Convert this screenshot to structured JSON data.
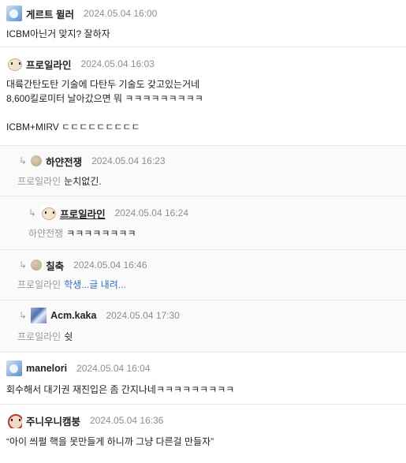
{
  "comments": [
    {
      "nick": "게르트 뮐러",
      "date": "2024.05.04 16:00",
      "avatar": "blue-mascot-icon",
      "lines": [
        "ICBM아닌거 맞지? 잘하자"
      ]
    },
    {
      "nick": "프로일라인",
      "date": "2024.05.04 16:03",
      "avatar": "puppy-icon",
      "lines": [
        "대륙간탄도탄 기술에 다탄두 기술도 갖고있는거네",
        "8,600킬로미터 날아갔으면 뭐 ㅋㅋㅋㅋㅋㅋㅋㅋㅋ",
        "",
        "ICBM+MIRV ㄷㄷㄷㄷㄷㄷㄷㄷㄷ"
      ]
    },
    {
      "nick": "하얀전쟁",
      "date": "2024.05.04 16:23",
      "avatar": "beige-circle-icon",
      "mention": "프로일라인",
      "text": "눈치없긴."
    },
    {
      "nick": "프로일라인",
      "date": "2024.05.04 16:24",
      "avatar": "puppy-icon",
      "mention": "하얀전쟁",
      "text": "ㅋㅋㅋㅋㅋㅋㅋㅋ"
    },
    {
      "nick": "칠축",
      "date": "2024.05.04 16:46",
      "avatar": "beige-circle-icon",
      "mention": "프로일라인",
      "text": "학생...글 내려..."
    },
    {
      "nick": "Acm.kaka",
      "date": "2024.05.04 17:30",
      "avatar": "pixel-art-icon",
      "mention": "프로일라인",
      "text": "쉿"
    },
    {
      "nick": "manelori",
      "date": "2024.05.04 16:04",
      "avatar": "blue-mascot-icon",
      "lines": [
        "회수해서 대기권 재진입은 좀 간지나네ㅋㅋㅋㅋㅋㅋㅋㅋㅋ"
      ]
    },
    {
      "nick": "주니우니캠붕",
      "date": "2024.05.04 16:36",
      "avatar": "dog-avatar-icon",
      "lines": [
        "“아이 씌펄 핵을 못만들게 하니까 그냥 다른걸 만들자”"
      ]
    }
  ],
  "colors": {
    "link": "#2f6fd0",
    "date": "#8a8f96",
    "mention": "#9a9a9a",
    "reply_background": "#fafafa"
  }
}
